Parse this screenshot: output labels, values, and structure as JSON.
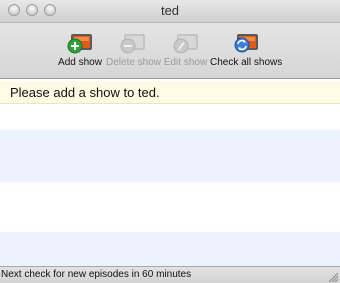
{
  "window": {
    "title": "ted"
  },
  "toolbar": {
    "add_show": {
      "label": "Add show",
      "icon": "add-show-icon",
      "enabled": true
    },
    "delete_show": {
      "label": "Delete show",
      "icon": "delete-show-icon",
      "enabled": false
    },
    "edit_show": {
      "label": "Edit show",
      "icon": "edit-show-icon",
      "enabled": false
    },
    "check_all_shows": {
      "label": "Check all shows",
      "icon": "check-all-shows-icon",
      "enabled": true
    }
  },
  "list": {
    "empty_message": "Please add a show to ted."
  },
  "status": {
    "text": "Next check for new episodes in 60 minutes"
  },
  "colors": {
    "message_row": "#fcfbe3",
    "stripe": "#edf3fe",
    "add_green": "#2fa33a",
    "tv_orange": "#e05a1a"
  }
}
